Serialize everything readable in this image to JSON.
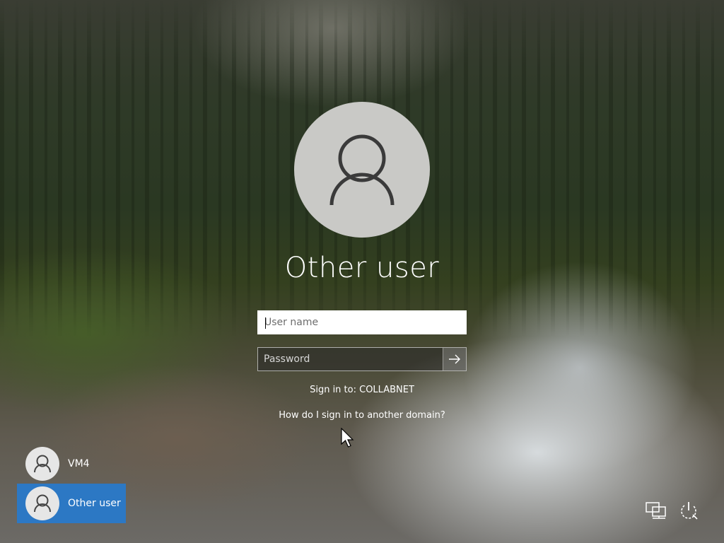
{
  "login": {
    "title": "Other user",
    "username_placeholder": "User name",
    "password_placeholder": "Password",
    "sign_in_to": "Sign in to: COLLABNET",
    "domain_help_link": "How do I sign in to another domain?"
  },
  "users": [
    {
      "name": "VM4",
      "selected": false
    },
    {
      "name": "Other user",
      "selected": true
    }
  ],
  "icons": {
    "avatar": "user-icon",
    "submit": "arrow-right-icon",
    "network": "network-icon",
    "power": "power-icon"
  },
  "colors": {
    "selection": "#2c78c4",
    "avatar_bg": "#c9c9c6"
  }
}
